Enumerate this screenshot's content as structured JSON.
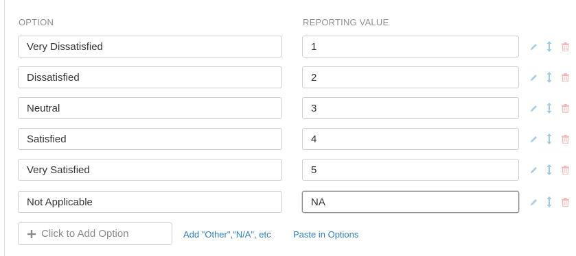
{
  "headers": {
    "option": "Option",
    "reporting_value": "Reporting Value"
  },
  "options": [
    {
      "label": "Very Dissatisfied",
      "value": "1"
    },
    {
      "label": "Dissatisfied",
      "value": "2"
    },
    {
      "label": "Neutral",
      "value": "3"
    },
    {
      "label": "Satisfied",
      "value": "4"
    },
    {
      "label": "Very Satisfied",
      "value": "5"
    },
    {
      "label": "Not Applicable",
      "value": "NA"
    }
  ],
  "row_icons": [
    "pencil-icon",
    "reorder-arrows-icon",
    "trash-icon"
  ],
  "footer": {
    "add_option_label": "Click to Add Option",
    "add_other_label": "Add \"Other\",\"N/A\", etc",
    "paste_label": "Paste in Options"
  },
  "colors": {
    "link": "#2d7fc1",
    "edit_icon": "#a9cfe8",
    "reorder_icon": "#9fcbe6",
    "delete_icon": "#f2b8b8",
    "header_text": "#8f8f8f"
  }
}
